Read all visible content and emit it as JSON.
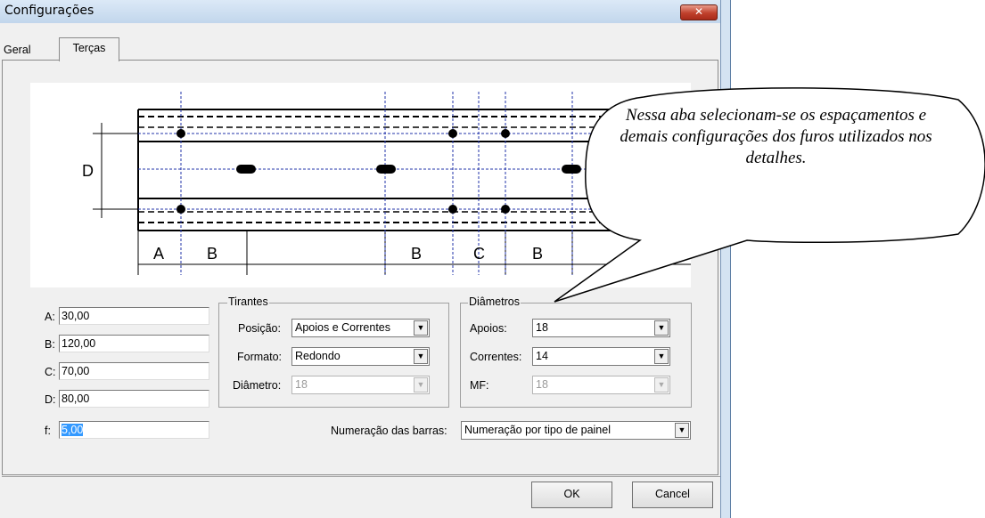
{
  "window": {
    "title": "Configurações",
    "close_glyph": "✕"
  },
  "tabs": [
    {
      "label": "Geral"
    },
    {
      "label": "Terças"
    }
  ],
  "diagram": {
    "labels": {
      "D": "D",
      "A": "A",
      "B": "B",
      "C": "C"
    }
  },
  "fields": {
    "A": {
      "label": "A:",
      "value": "30,00"
    },
    "B": {
      "label": "B:",
      "value": "120,00"
    },
    "C": {
      "label": "C:",
      "value": "70,00"
    },
    "D": {
      "label": "D:",
      "value": "80,00"
    },
    "f": {
      "label": "f:",
      "value": "5,00"
    }
  },
  "tirantes": {
    "title": "Tirantes",
    "posicao": {
      "label": "Posição:",
      "value": "Apoios e Correntes"
    },
    "formato": {
      "label": "Formato:",
      "value": "Redondo"
    },
    "diametro": {
      "label": "Diâmetro:",
      "value": "18"
    }
  },
  "diametros": {
    "title": "Diâmetros",
    "apoios": {
      "label": "Apoios:",
      "value": "18"
    },
    "correntes": {
      "label": "Correntes:",
      "value": "14"
    },
    "mf": {
      "label": "MF:",
      "value": "18"
    }
  },
  "numeracao": {
    "label": "Numeração das barras:",
    "value": "Numeração por tipo de painel"
  },
  "buttons": {
    "ok": "OK",
    "cancel": "Cancel"
  },
  "callout": {
    "text": "Nessa aba selecionam-se os espaçamentos e demais configurações dos furos utilizados nos detalhes."
  },
  "icons": {
    "dropdown": "▼"
  }
}
